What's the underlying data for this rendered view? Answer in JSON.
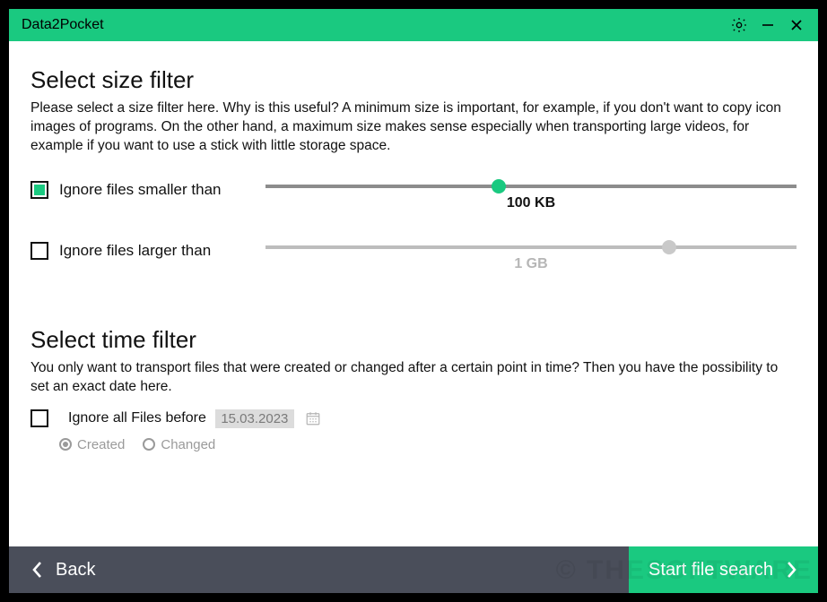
{
  "app": {
    "title": "Data2Pocket"
  },
  "size_filter": {
    "title": "Select size filter",
    "desc": "Please select a size filter here. Why is this useful? A minimum size is important, for example, if you don't want to copy icon images of programs. On the other hand, a maximum size makes sense especially when transporting large videos, for example if you want to use a stick with little storage space.",
    "smaller": {
      "label": "Ignore files smaller than",
      "checked": true,
      "value_label": "100 KB",
      "thumb_pct": 44
    },
    "larger": {
      "label": "Ignore files larger than",
      "checked": false,
      "value_label": "1 GB",
      "thumb_pct": 76
    }
  },
  "time_filter": {
    "title": "Select time filter",
    "desc": "You only want to transport files that were created or changed after a certain point in time? Then you have the possibility to set an exact date here.",
    "ignore_before": {
      "label": "Ignore all Files before",
      "checked": false,
      "date": "15.03.2023"
    },
    "radios": {
      "created": "Created",
      "changed": "Changed",
      "selected": "created"
    }
  },
  "footer": {
    "back": "Back",
    "start": "Start file search"
  },
  "watermark": "© THESOFTWARE"
}
